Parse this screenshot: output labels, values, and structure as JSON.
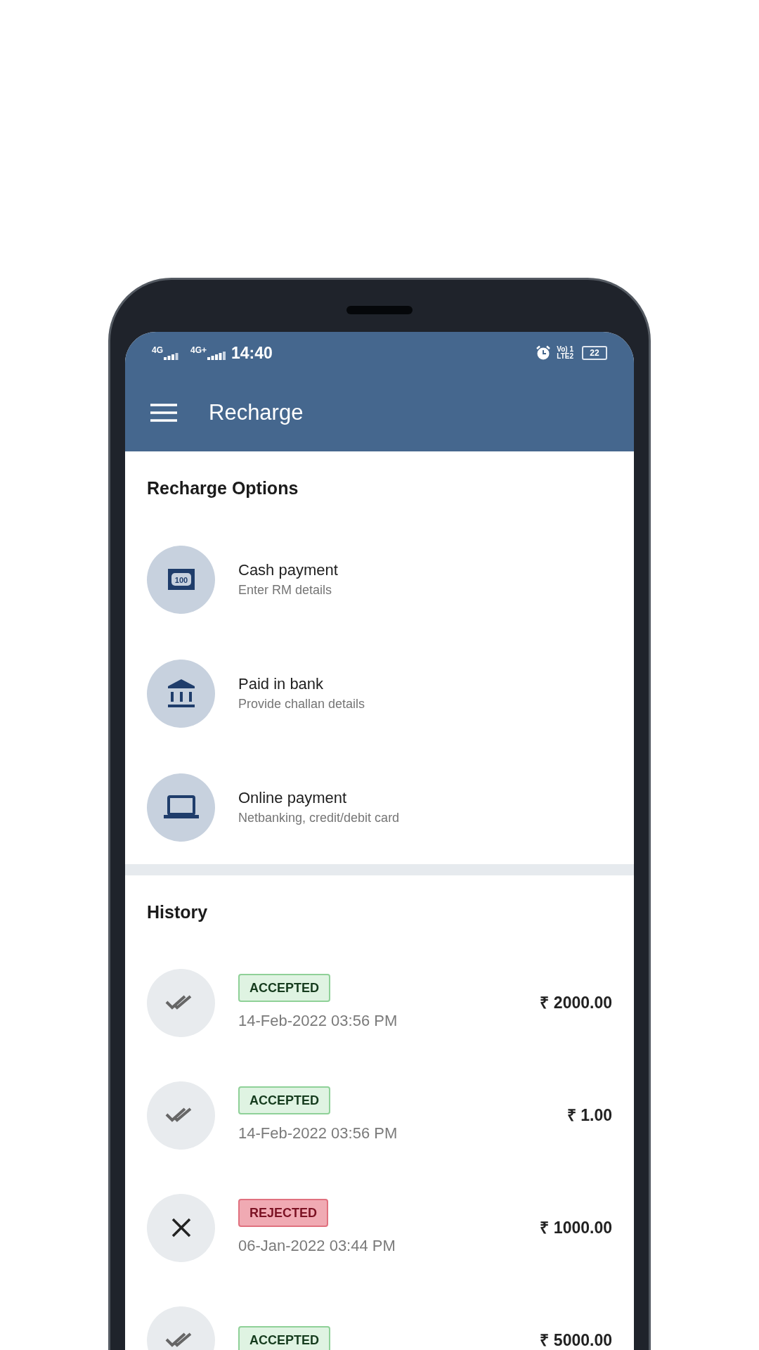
{
  "status_bar": {
    "sim1_network": "4G",
    "sim2_network": "4G+",
    "time": "14:40",
    "volte": "Vo) 1",
    "lte": "LTE2",
    "battery": "22"
  },
  "app_bar": {
    "title": "Recharge"
  },
  "recharge_options": {
    "heading": "Recharge Options",
    "items": [
      {
        "kind": "cash",
        "icon_label": "100",
        "title": "Cash payment",
        "subtitle": "Enter RM details"
      },
      {
        "kind": "bank",
        "title": "Paid in bank",
        "subtitle": "Provide challan details"
      },
      {
        "kind": "online",
        "title": "Online payment",
        "subtitle": "Netbanking, credit/debit card"
      }
    ]
  },
  "history": {
    "heading": "History",
    "items": [
      {
        "kind": "accepted",
        "badge": "ACCEPTED",
        "date": "14-Feb-2022 03:56 PM",
        "amount": "₹ 2000.00"
      },
      {
        "kind": "accepted",
        "badge": "ACCEPTED",
        "date": "14-Feb-2022 03:56 PM",
        "amount": "₹ 1.00"
      },
      {
        "kind": "rejected",
        "badge": "REJECTED",
        "date": "06-Jan-2022 03:44 PM",
        "amount": "₹ 1000.00"
      },
      {
        "kind": "accepted",
        "badge": "ACCEPTED",
        "amount": "₹ 5000.00"
      }
    ]
  }
}
